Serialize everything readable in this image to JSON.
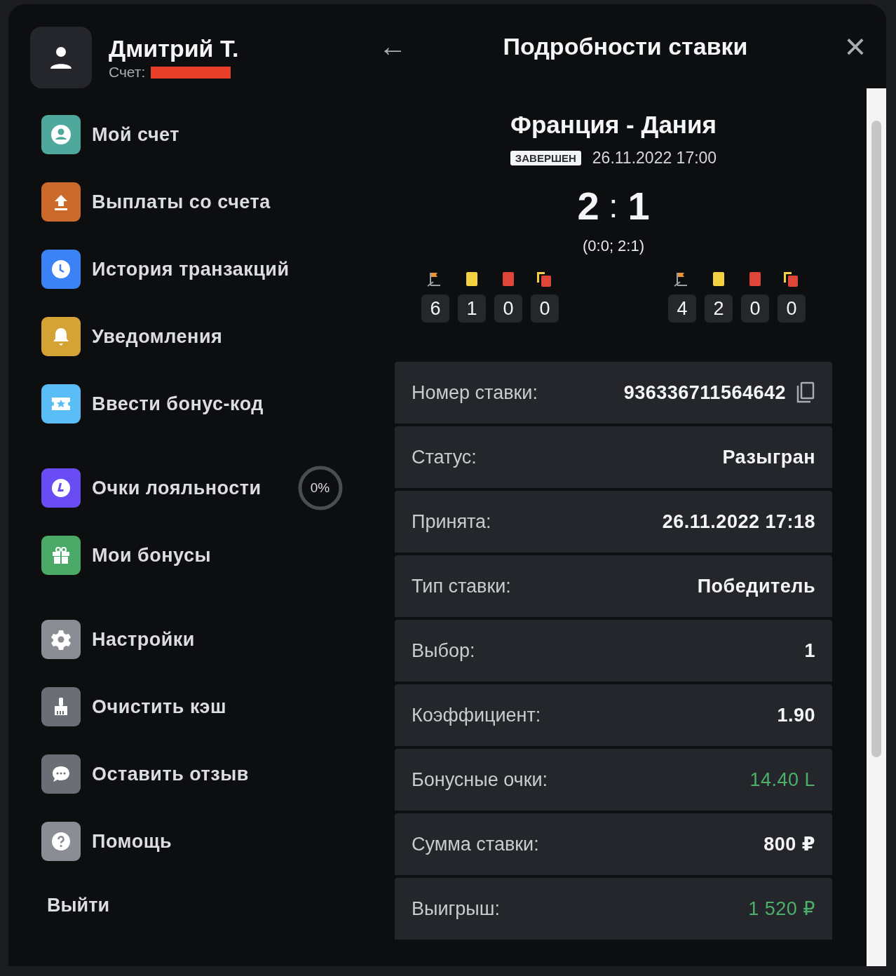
{
  "profile": {
    "name": "Дмитрий Т.",
    "account_label": "Счет:"
  },
  "menu_groups": [
    [
      {
        "kind": "account",
        "label": "Мой счет",
        "color": "#4fa89c"
      },
      {
        "kind": "withdraw",
        "label": "Выплаты со счета",
        "color": "#cc6a2c"
      },
      {
        "kind": "history",
        "label": "История транзакций",
        "color": "#3b82f6"
      },
      {
        "kind": "notifications",
        "label": "Уведомления",
        "color": "#d4a334"
      },
      {
        "kind": "bonus-code",
        "label": "Ввести бонус-код",
        "color": "#5bbdf5"
      }
    ],
    [
      {
        "kind": "loyalty",
        "label": "Очки лояльности",
        "color": "#6a4cf5",
        "progress": {
          "text": "0%"
        }
      },
      {
        "kind": "gift",
        "label": "Мои бонусы",
        "color": "#4caa68"
      }
    ],
    [
      {
        "kind": "settings",
        "label": "Настройки",
        "color": "#8a8d93"
      },
      {
        "kind": "cache",
        "label": "Очистить кэш",
        "color": "#6b6e74"
      },
      {
        "kind": "feedback",
        "label": "Оставить отзыв",
        "color": "#6b6e74"
      },
      {
        "kind": "help",
        "label": "Помощь",
        "color": "#8a8d93"
      }
    ]
  ],
  "logout": "Выйти",
  "header": {
    "back": "←",
    "title": "Подробности ставки",
    "close": "×"
  },
  "match": {
    "teams": "Франция - Дания",
    "status": "ЗАВЕРШЕН",
    "date": "26.11.2022 17:00",
    "score_home": "2",
    "score_sep": ":",
    "score_away": "1",
    "halves": "(0:0; 2:1)",
    "stats": [
      [
        {
          "kind": "corners",
          "value": "6"
        },
        {
          "kind": "yellow",
          "value": "1"
        },
        {
          "kind": "red",
          "value": "0"
        },
        {
          "kind": "yellow-red",
          "value": "0"
        }
      ],
      [
        {
          "kind": "corners",
          "value": "4"
        },
        {
          "kind": "yellow",
          "value": "2"
        },
        {
          "kind": "red",
          "value": "0"
        },
        {
          "kind": "yellow-red",
          "value": "0"
        }
      ]
    ]
  },
  "details": [
    {
      "label": "Номер ставки:",
      "value": "936336711564642",
      "copy": true,
      "highlight": false
    },
    {
      "label": "Статус:",
      "value": "Разыгран",
      "copy": false,
      "highlight": false
    },
    {
      "label": "Принята:",
      "value": "26.11.2022 17:18",
      "copy": false,
      "highlight": false
    },
    {
      "label": "Тип ставки:",
      "value": "Победитель",
      "copy": false,
      "highlight": false
    },
    {
      "label": "Выбор:",
      "value": "1",
      "copy": false,
      "highlight": false
    },
    {
      "label": "Коэффициент:",
      "value": "1.90",
      "copy": false,
      "highlight": false
    },
    {
      "label": "Бонусные очки:",
      "value": "14.40 L",
      "copy": false,
      "highlight": true
    },
    {
      "label": "Сумма ставки:",
      "value": "800 ₽",
      "copy": false,
      "highlight": false
    },
    {
      "label": "Выигрыш:",
      "value": "1 520 ₽",
      "copy": false,
      "highlight": true
    }
  ]
}
